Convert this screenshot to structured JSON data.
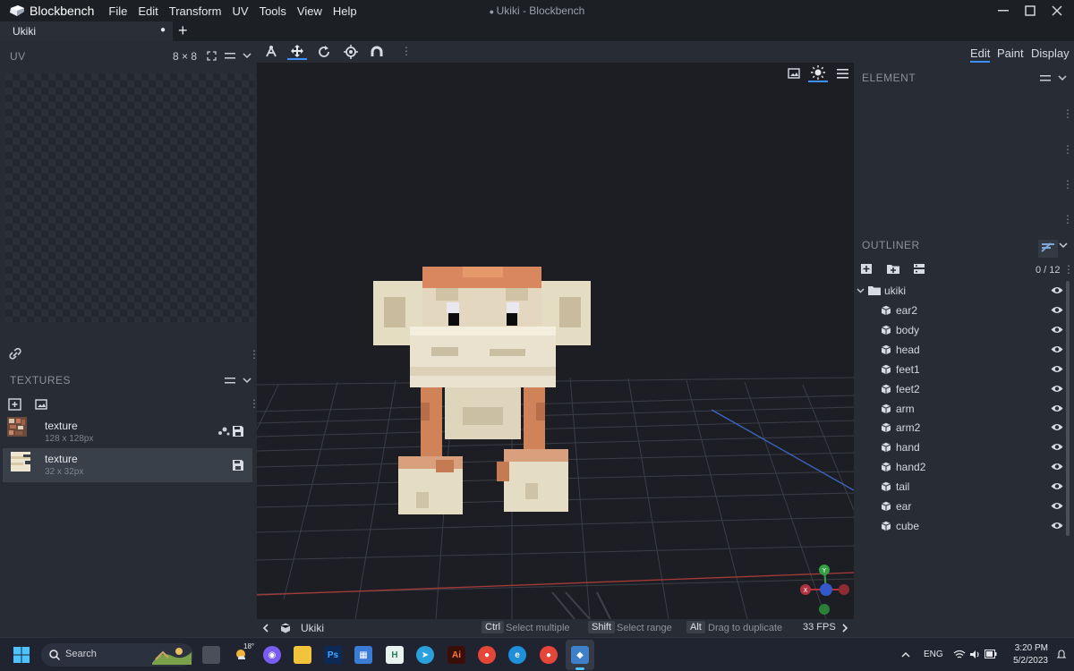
{
  "app": {
    "name": "Blockbench",
    "window_title": "Ukiki - Blockbench",
    "menu": [
      "File",
      "Edit",
      "Transform",
      "UV",
      "Tools",
      "View",
      "Help"
    ]
  },
  "tabs": {
    "active": "Ukiki",
    "add": "+"
  },
  "uv_panel": {
    "title": "UV",
    "grid_size": "8 × 8"
  },
  "textures_panel": {
    "title": "TEXTURES",
    "items": [
      {
        "name": "texture",
        "size": "128 x 128px"
      },
      {
        "name": "texture",
        "size": "32 x 32px"
      }
    ]
  },
  "modes": [
    "Edit",
    "Paint",
    "Display"
  ],
  "active_mode": "Edit",
  "element_panel": {
    "title": "ELEMENT"
  },
  "outliner": {
    "title": "OUTLINER",
    "count": "0 / 12",
    "group": "ukiki",
    "items": [
      "ear2",
      "body",
      "head",
      "feet1",
      "feet2",
      "arm",
      "arm2",
      "hand",
      "hand2",
      "tail",
      "ear",
      "cube"
    ]
  },
  "viewport": {
    "gizmo_axes": [
      "Y",
      "X",
      "Z"
    ]
  },
  "status": {
    "model_name": "Ukiki",
    "hints": [
      {
        "key": "Ctrl",
        "text": "Select multiple"
      },
      {
        "key": "Shift",
        "text": "Select range"
      },
      {
        "key": "Alt",
        "text": "Drag to duplicate"
      }
    ],
    "fps": "33 FPS"
  },
  "taskbar": {
    "search_placeholder": "Search",
    "weather": "18°",
    "language": "ENG",
    "time": "3:20 PM",
    "date": "5/2/2023"
  },
  "colors": {
    "accent": "#3e90ff",
    "panel_bg": "#282c34",
    "viewport_bg": "#1c1e23",
    "titlebar_bg": "#1c1f24",
    "monkey_cream": "#e3d8bf",
    "monkey_orange": "#d9875f"
  }
}
